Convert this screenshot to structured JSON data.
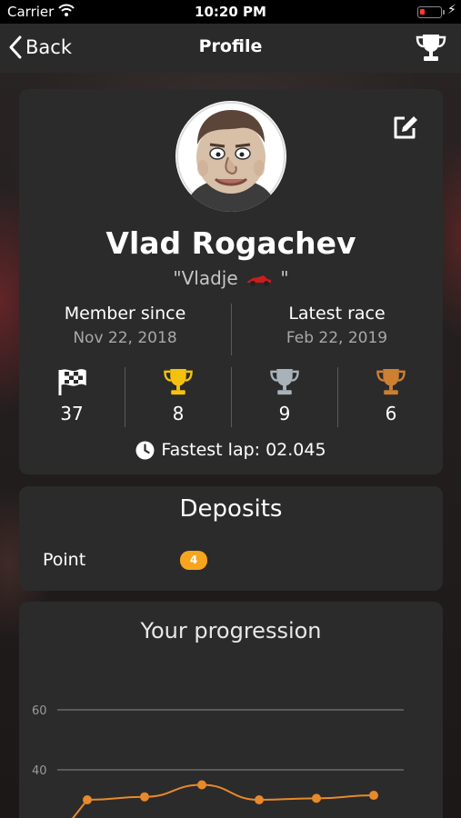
{
  "status_bar": {
    "carrier": "Carrier",
    "time": "10:20 PM"
  },
  "nav": {
    "back_label": "Back",
    "title": "Profile"
  },
  "profile": {
    "name": "Vlad Rogachev",
    "nickname_open": "\"Vladje",
    "nickname_close": "\"",
    "member_since_label": "Member since",
    "member_since_value": "Nov 22, 2018",
    "latest_race_label": "Latest race",
    "latest_race_value": "Feb 22, 2019",
    "stats": [
      {
        "icon": "checkered-flag-icon",
        "value": "37"
      },
      {
        "icon": "gold-trophy-icon",
        "value": "8",
        "color": "#f4c20d"
      },
      {
        "icon": "silver-trophy-icon",
        "value": "9",
        "color": "#a9b2b8"
      },
      {
        "icon": "bronze-trophy-icon",
        "value": "6",
        "color": "#cd7f32"
      }
    ],
    "fastest_lap": "Fastest lap: 02.045"
  },
  "deposits": {
    "title": "Deposits",
    "label": "Point",
    "badge_value": "4",
    "badge_color": "#f7a520"
  },
  "progression": {
    "title": "Your progression"
  },
  "chart_data": {
    "type": "line",
    "title": "Your progression",
    "ytick_labels": [
      "60",
      "40"
    ],
    "series": [
      {
        "values": [
          30,
          31,
          35,
          30,
          30.5,
          31.5
        ]
      }
    ],
    "line_color": "#e8892a",
    "partial_points": 1,
    "grid": true
  },
  "colors": {
    "accent": "#f7a520",
    "card_bg": "#2b2b2b",
    "navbar_bg": "#2a2a2a"
  }
}
